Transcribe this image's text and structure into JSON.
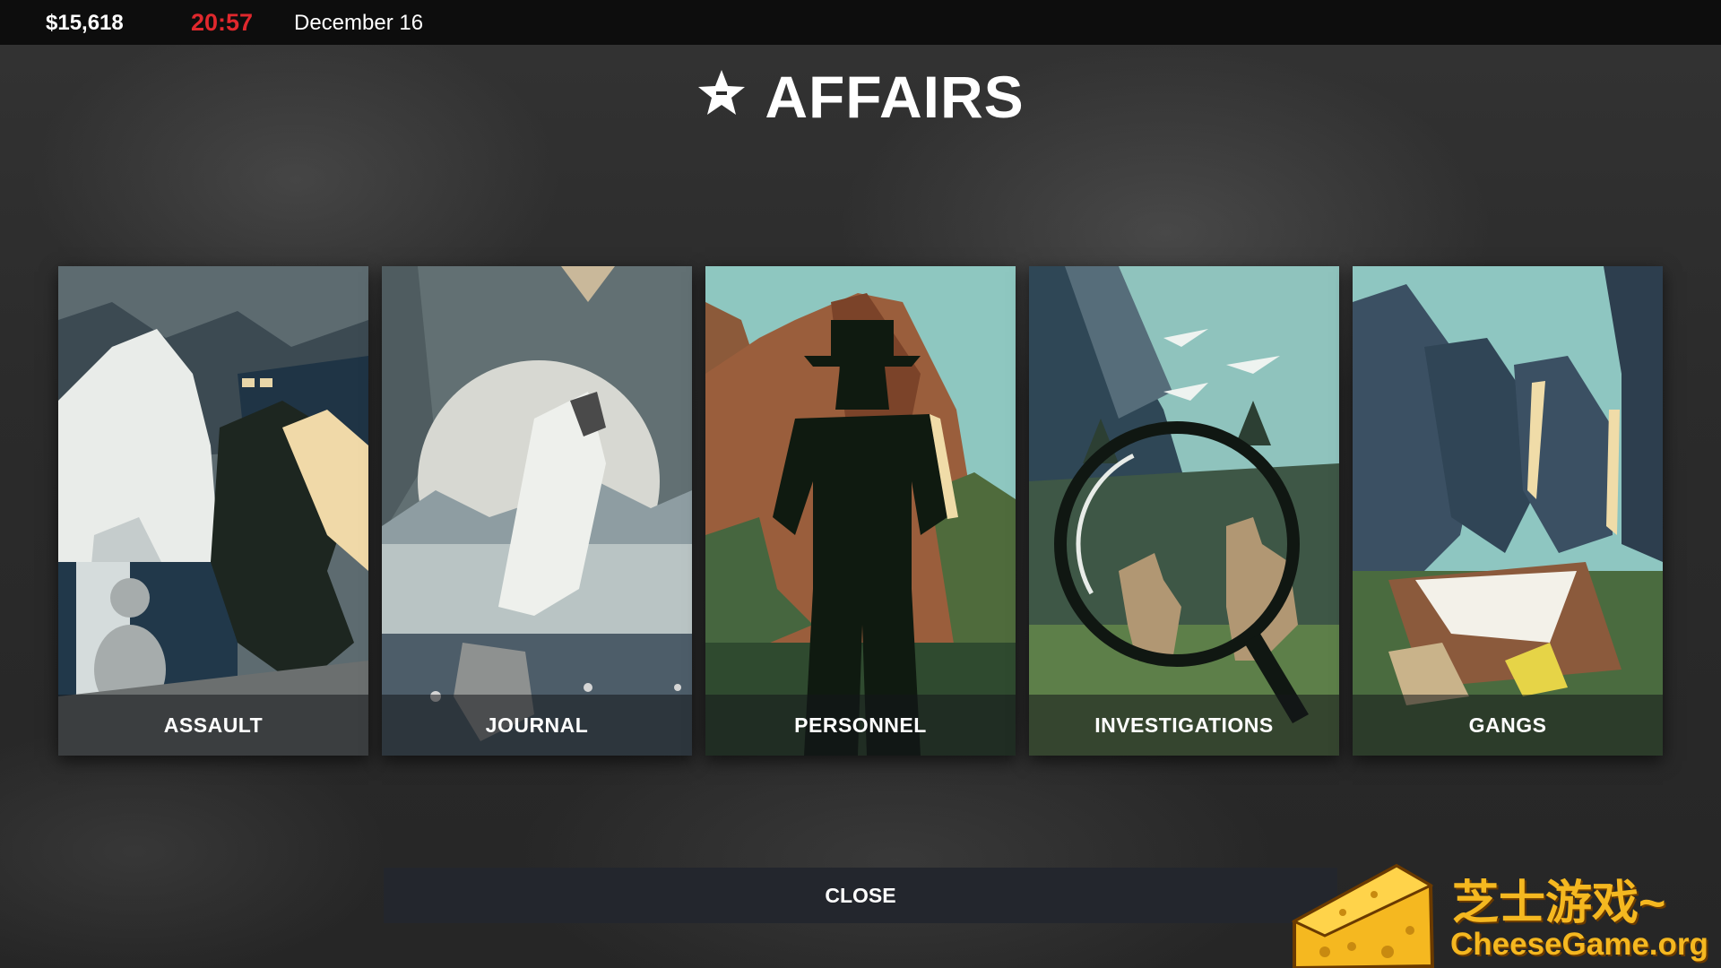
{
  "hud": {
    "money": "$15,618",
    "time": "20:57",
    "date": "December 16"
  },
  "title": "AFFAIRS",
  "title_icon": "star-icon",
  "cards": [
    {
      "label": "ASSAULT",
      "art": "snow-fort-illustration"
    },
    {
      "label": "JOURNAL",
      "art": "frozen-lake-moon-illustration"
    },
    {
      "label": "PERSONNEL",
      "art": "ranger-silhouette-illustration"
    },
    {
      "label": "INVESTIGATIONS",
      "art": "magnifier-deer-illustration"
    },
    {
      "label": "GANGS",
      "art": "gang-silhouettes-illustration"
    }
  ],
  "close_label": "CLOSE",
  "watermark": {
    "cn": "芝士游戏~",
    "en": "CheeseGame.org"
  },
  "colors": {
    "clock": "#e0282d",
    "topbar": "#0d0d0d",
    "close_button": "#23262d"
  }
}
